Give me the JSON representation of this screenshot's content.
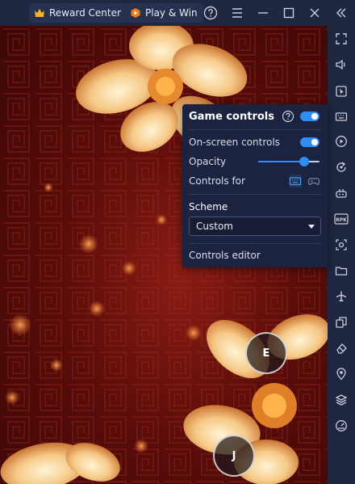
{
  "topbar": {
    "reward_center": "Reward Center",
    "play_win": "Play & Win",
    "icons": [
      "crown-icon",
      "play-win-icon",
      "help-icon",
      "menu-icon",
      "minimize-icon",
      "maximize-icon",
      "close-icon",
      "collapse-sidebar-icon"
    ]
  },
  "sidebar": {
    "icons": [
      "fullscreen-icon",
      "volume-icon",
      "pointer-icon",
      "keyboard-icon",
      "macro-play-icon",
      "rotate-icon",
      "gamepad-icon",
      "apk-icon",
      "screenshot-icon",
      "folder-icon",
      "airplane-icon",
      "multi-instance-icon",
      "eraser-icon",
      "location-icon",
      "layers-icon",
      "speed-icon"
    ],
    "apk_label": "RPK"
  },
  "keys": {
    "e": "E",
    "j": "J"
  },
  "game_controls": {
    "title": "Game controls",
    "enabled": true,
    "on_screen_label": "On-screen controls",
    "on_screen_enabled": true,
    "opacity_label": "Opacity",
    "opacity_value": 0.8,
    "controls_for_label": "Controls for",
    "scheme_label": "Scheme",
    "scheme_value": "Custom",
    "editor_label": "Controls editor"
  },
  "colors": {
    "accent": "#2f8cf0",
    "panel_bg": "#1b2340",
    "chrome_bg": "#1e2640"
  }
}
